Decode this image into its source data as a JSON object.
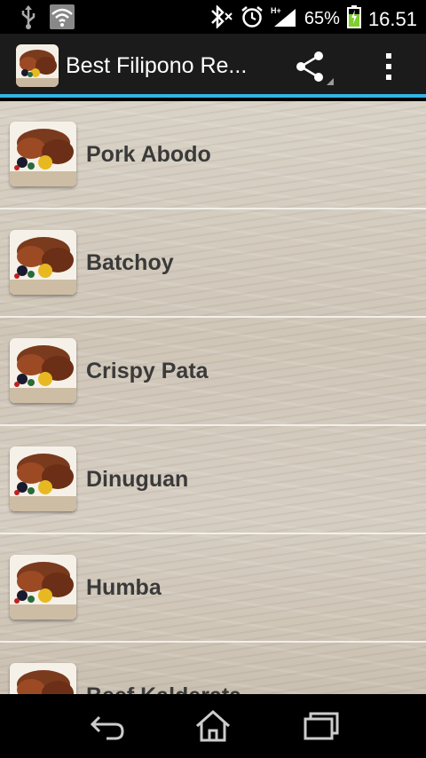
{
  "status_bar": {
    "battery_percent": "65%",
    "time": "16.51",
    "icons": [
      "usb-icon",
      "wifi-icon",
      "bluetooth-icon",
      "alarm-icon",
      "signal-icon",
      "battery-icon"
    ]
  },
  "action_bar": {
    "title": "Best Filipono Re...",
    "icons": [
      "app-icon",
      "share-icon",
      "overflow-menu-icon"
    ],
    "accent_color": "#33b5e5"
  },
  "list": {
    "items": [
      {
        "label": "Pork Abodo"
      },
      {
        "label": "Batchoy"
      },
      {
        "label": "Crispy Pata"
      },
      {
        "label": "Dinuguan"
      },
      {
        "label": "Humba"
      },
      {
        "label": "Beef Kalderata"
      }
    ]
  },
  "nav_bar": {
    "icons": [
      "back-icon",
      "home-icon",
      "recents-icon"
    ]
  }
}
